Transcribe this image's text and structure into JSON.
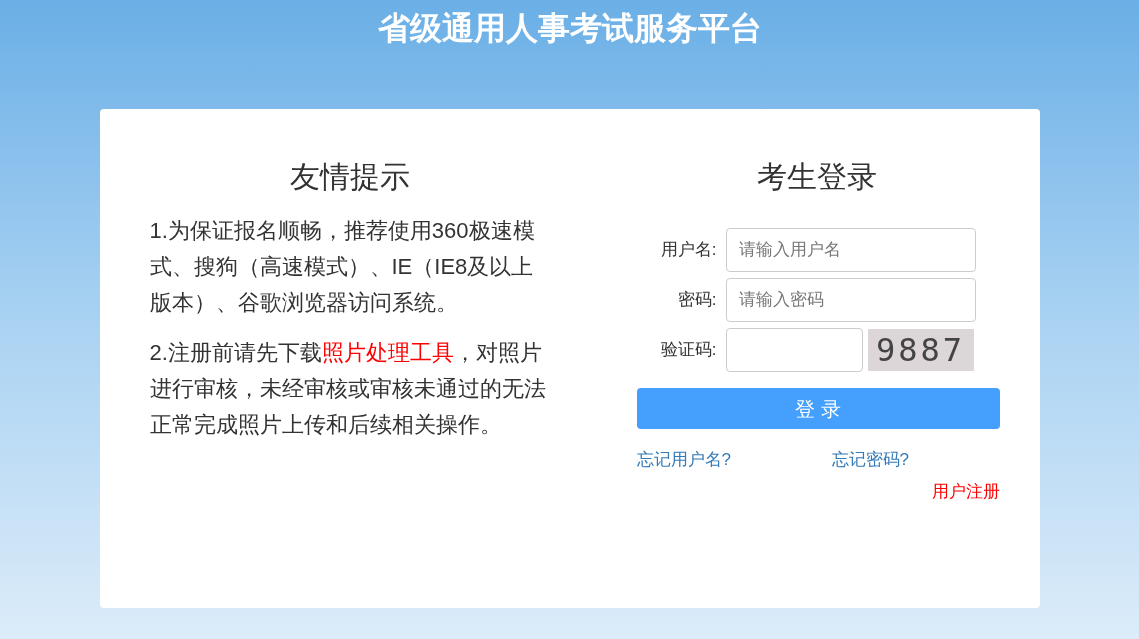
{
  "header": {
    "title": "省级通用人事考试服务平台"
  },
  "tips": {
    "title": "友情提示",
    "items": [
      {
        "text": "1.为保证报名顺畅，推荐使用360极速模式、搜狗（高速模式）、IE（IE8及以上版本）、谷歌浏览器访问系统。"
      },
      {
        "text": "2.注册前请先下载",
        "link": "照片处理工具",
        "after": "，对照片进行审核，未经审核或审核未通过的无法正常完成照片上传和后续相关操作。"
      }
    ]
  },
  "login": {
    "title": "考生登录",
    "fields": [
      {
        "kind": "text",
        "label": "用户名:",
        "placeholder": "请输入用户名"
      },
      {
        "kind": "password",
        "label": "密码:",
        "placeholder": "请输入密码"
      },
      {
        "kind": "captcha",
        "label": "验证码:",
        "captcha": "9887"
      }
    ],
    "submit": "登 录",
    "forgot_username": "忘记用户名?",
    "forgot_password": "忘记密码?",
    "register": "用户注册"
  }
}
